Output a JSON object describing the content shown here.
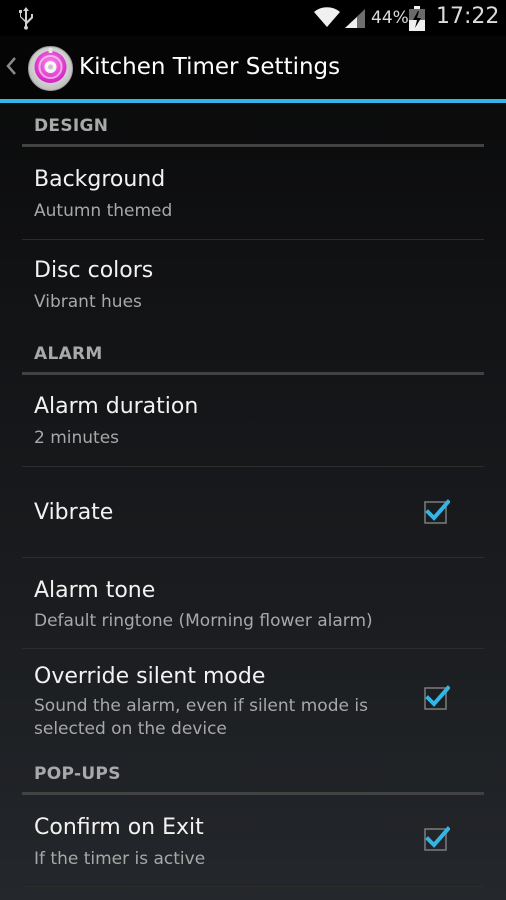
{
  "status_bar": {
    "battery_percent": "44%",
    "time": "17:22",
    "icons": [
      "usb-icon",
      "wifi-icon",
      "signal-icon",
      "battery-charging-icon"
    ]
  },
  "action_bar": {
    "title": "Kitchen Timer Settings",
    "accent_color": "#33b5e5"
  },
  "categories": {
    "design": "DESIGN",
    "alarm": "ALARM",
    "popups": "POP-UPS"
  },
  "prefs": {
    "background": {
      "title": "Background",
      "summary": "Autumn themed"
    },
    "disc_colors": {
      "title": "Disc colors",
      "summary": "Vibrant hues"
    },
    "alarm_duration": {
      "title": "Alarm duration",
      "summary": "2 minutes"
    },
    "vibrate": {
      "title": "Vibrate",
      "checked": true
    },
    "alarm_tone": {
      "title": "Alarm tone",
      "summary": "Default ringtone (Morning flower alarm)"
    },
    "override_silent": {
      "title": "Override silent mode",
      "summary": "Sound the alarm, even if silent mode is selected on the device",
      "checked": true
    },
    "confirm_exit": {
      "title": "Confirm on Exit",
      "summary": "If the timer is active",
      "checked": true
    }
  }
}
